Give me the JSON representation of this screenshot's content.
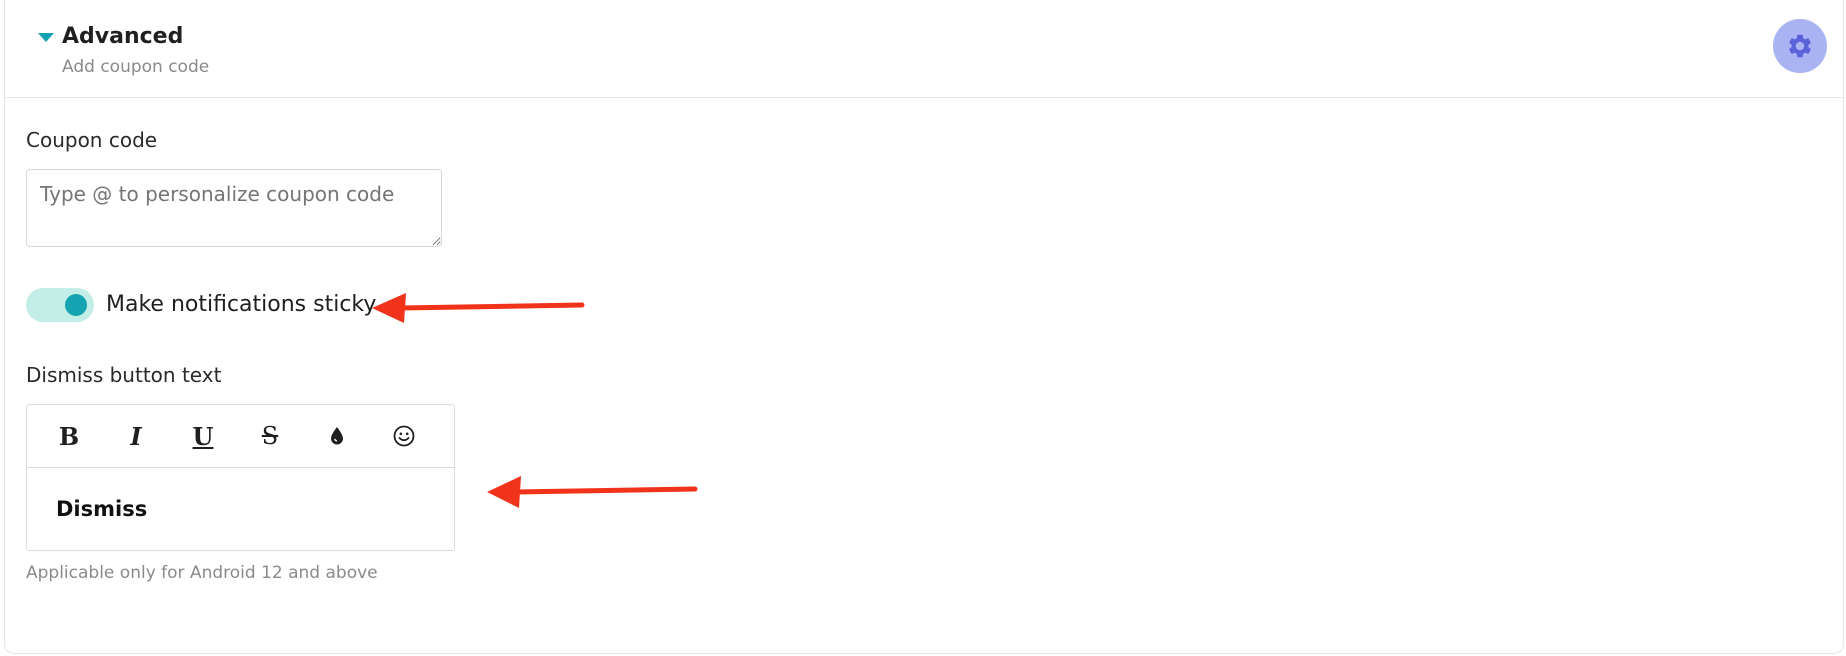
{
  "section": {
    "title": "Advanced",
    "subtitle": "Add coupon code"
  },
  "coupon": {
    "label": "Coupon code",
    "value": "",
    "placeholder": "Type @ to personalize coupon code"
  },
  "sticky_toggle": {
    "label": "Make notifications sticky",
    "enabled": true
  },
  "dismiss": {
    "label": "Dismiss button text",
    "value": "Dismiss",
    "help": "Applicable only for Android 12 and above"
  },
  "toolbar": {
    "bold": "B",
    "italic": "I",
    "underline": "U",
    "strikethrough": "S",
    "color_icon": "ink-drop-icon",
    "emoji_icon": "smiley-icon"
  },
  "colors": {
    "accent": "#14a3b0",
    "toggle_track": "#c3eee7",
    "gear_bg": "#aab3f3",
    "gear_fg": "#5a63d8",
    "annotation_arrow": "#f2331c"
  }
}
